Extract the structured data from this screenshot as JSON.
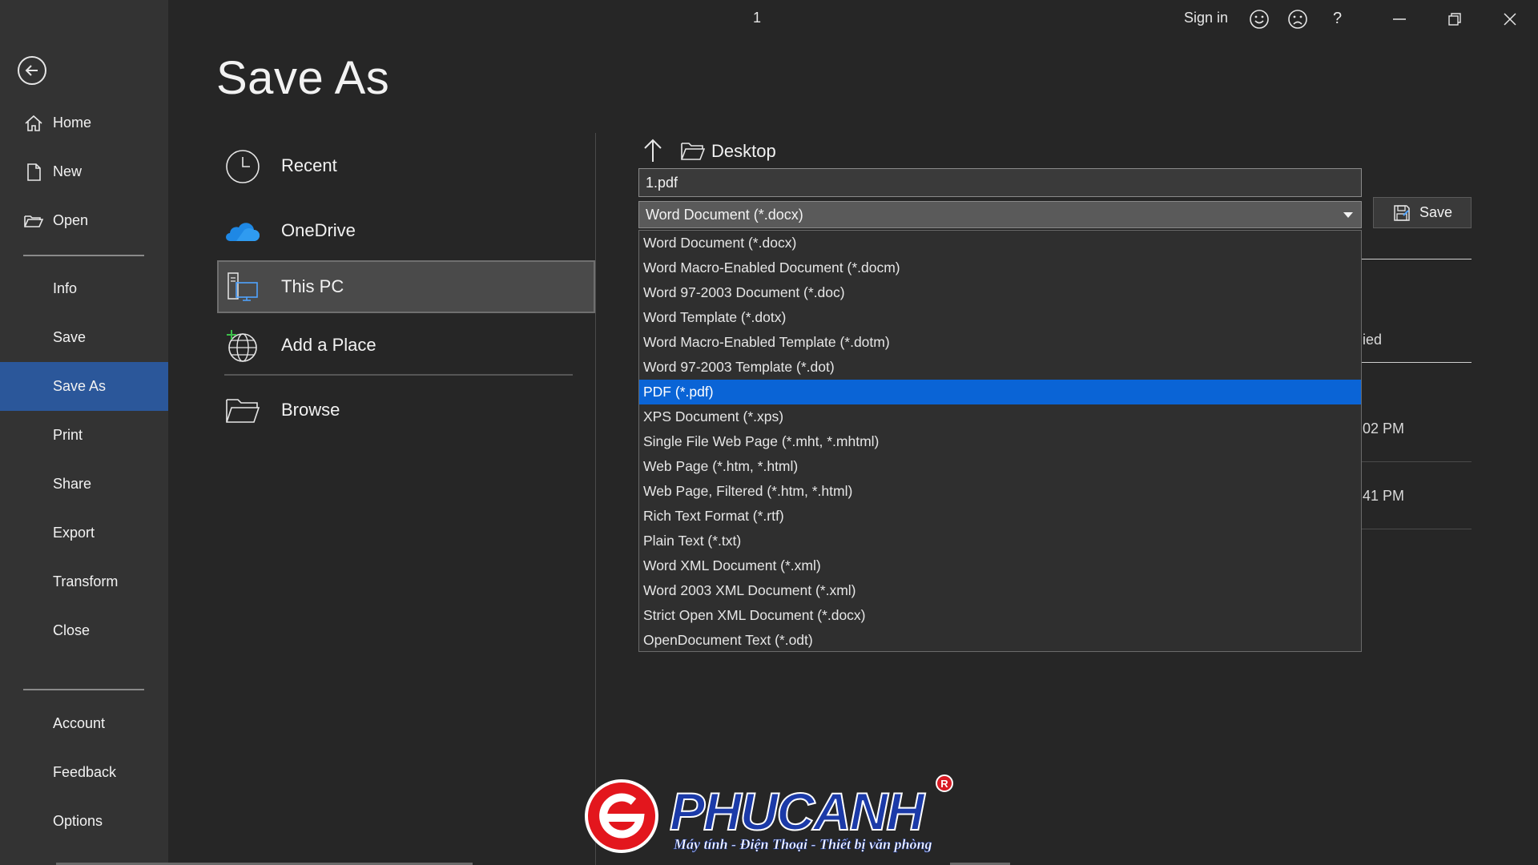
{
  "titlebar": {
    "doc_title": "1",
    "sign_in": "Sign in",
    "icons": [
      "smile-icon",
      "frown-icon",
      "help-icon",
      "minimize-icon",
      "restore-icon",
      "close-icon"
    ],
    "help_glyph": "?"
  },
  "nav": {
    "items": [
      {
        "label": "Home",
        "icon": "home-icon"
      },
      {
        "label": "New",
        "icon": "new-document-icon"
      },
      {
        "label": "Open",
        "icon": "open-folder-icon"
      },
      {
        "label": "Info"
      },
      {
        "label": "Save"
      },
      {
        "label": "Save As",
        "active": true
      },
      {
        "label": "Print"
      },
      {
        "label": "Share"
      },
      {
        "label": "Export"
      },
      {
        "label": "Transform"
      },
      {
        "label": "Close"
      },
      {
        "label": "Account"
      },
      {
        "label": "Feedback"
      },
      {
        "label": "Options"
      }
    ],
    "active_color": "#2b579a"
  },
  "page": {
    "title": "Save As"
  },
  "locations": [
    {
      "label": "Recent",
      "icon": "clock-icon"
    },
    {
      "label": "OneDrive",
      "icon": "cloud-icon"
    },
    {
      "label": "This PC",
      "icon": "computer-icon",
      "selected": true
    },
    {
      "label": "Add a Place",
      "icon": "globe-add-icon"
    },
    {
      "label": "Browse",
      "icon": "folder-icon"
    }
  ],
  "right": {
    "folder": "Desktop",
    "filename": "1.pdf",
    "file_type": "Word Document (*.docx)",
    "save_label": "Save",
    "fragments": {
      "column_header_tail": "ied",
      "time1_tail": "02 PM",
      "time2_tail": "41 PM"
    }
  },
  "dropdown": {
    "options": [
      "Word Document (*.docx)",
      "Word Macro-Enabled Document (*.docm)",
      "Word 97-2003 Document (*.doc)",
      "Word Template (*.dotx)",
      "Word Macro-Enabled Template (*.dotm)",
      "Word 97-2003 Template (*.dot)",
      "PDF (*.pdf)",
      "XPS Document (*.xps)",
      "Single File Web Page (*.mht, *.mhtml)",
      "Web Page (*.htm, *.html)",
      "Web Page, Filtered (*.htm, *.html)",
      "Rich Text Format (*.rtf)",
      "Plain Text (*.txt)",
      "Word XML Document (*.xml)",
      "Word 2003 XML Document (*.xml)",
      "Strict Open XML Document (*.docx)",
      "OpenDocument Text (*.odt)"
    ],
    "highlighted_index": 6,
    "highlight_color": "#0a64d6"
  },
  "watermark": {
    "brand": "PHUCANH",
    "tagline": "Máy tính - Điện Thoại - Thiết bị văn phòng",
    "registered": "R"
  }
}
